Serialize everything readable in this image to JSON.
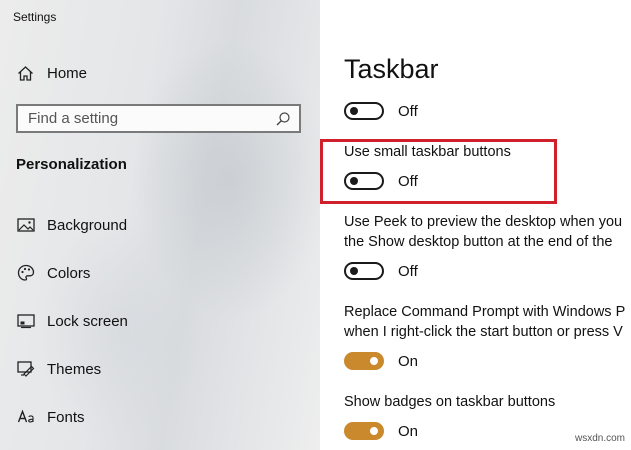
{
  "window": {
    "title": "Settings"
  },
  "sidebar": {
    "home_label": "Home",
    "search_placeholder": "Find a setting",
    "section_title": "Personalization",
    "items": [
      {
        "label": "Background",
        "icon": "image-icon"
      },
      {
        "label": "Colors",
        "icon": "palette-icon"
      },
      {
        "label": "Lock screen",
        "icon": "lock-screen-icon"
      },
      {
        "label": "Themes",
        "icon": "themes-icon"
      },
      {
        "label": "Fonts",
        "icon": "fonts-icon"
      }
    ]
  },
  "main": {
    "title": "Taskbar",
    "settings": [
      {
        "label_lines": [],
        "state": "Off",
        "on": false
      },
      {
        "label_lines": [
          "Use small taskbar buttons"
        ],
        "state": "Off",
        "on": false,
        "highlighted": true
      },
      {
        "label_lines": [
          "Use Peek to preview the desktop when you",
          "the Show desktop button at the end of the"
        ],
        "state": "Off",
        "on": false
      },
      {
        "label_lines": [
          "Replace Command Prompt with Windows P",
          "when I right-click the start button or press V"
        ],
        "state": "On",
        "on": true
      },
      {
        "label_lines": [
          "Show badges on taskbar buttons"
        ],
        "state": "On",
        "on": true
      }
    ]
  },
  "colors": {
    "accent": "#c9892c",
    "highlight_box": "#d0202c"
  },
  "watermark": "wsxdn.com"
}
